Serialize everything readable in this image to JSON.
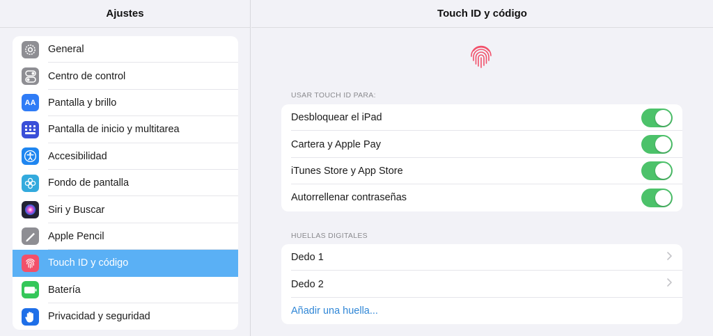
{
  "sidebar": {
    "title": "Ajustes",
    "items": [
      {
        "label": "General",
        "icon": "gear-icon",
        "color": "#8e8e93"
      },
      {
        "label": "Centro de control",
        "icon": "toggles-icon",
        "color": "#8e8e93"
      },
      {
        "label": "Pantalla y brillo",
        "icon": "text-size-icon",
        "color": "#2f7cf6"
      },
      {
        "label": "Pantalla de inicio y multitarea",
        "icon": "grid-icon",
        "color": "#3a4fd8"
      },
      {
        "label": "Accesibilidad",
        "icon": "accessibility-icon",
        "color": "#1f86f0"
      },
      {
        "label": "Fondo de pantalla",
        "icon": "flower-icon",
        "color": "#33aadd"
      },
      {
        "label": "Siri y Buscar",
        "icon": "siri-icon",
        "color": "#222233"
      },
      {
        "label": "Apple Pencil",
        "icon": "pencil-icon",
        "color": "#8e8e93"
      },
      {
        "label": "Touch ID y código",
        "icon": "fingerprint-icon",
        "color": "#f2506a",
        "selected": true
      },
      {
        "label": "Batería",
        "icon": "battery-icon",
        "color": "#34c759"
      },
      {
        "label": "Privacidad y seguridad",
        "icon": "hand-icon",
        "color": "#1f6fe8"
      }
    ],
    "text_size_glyph": "AA"
  },
  "detail": {
    "title": "Touch ID y código",
    "use_section_title": "USAR TOUCH ID PARA:",
    "use_rows": [
      {
        "label": "Desbloquear el iPad",
        "on": true
      },
      {
        "label": "Cartera y Apple Pay",
        "on": true
      },
      {
        "label": "iTunes Store y App Store",
        "on": true
      },
      {
        "label": "Autorrellenar contraseñas",
        "on": true
      }
    ],
    "fingerprints_section_title": "HUELLAS DIGITALES",
    "fingerprint_rows": [
      {
        "label": "Dedo 1"
      },
      {
        "label": "Dedo 2"
      }
    ],
    "add_fingerprint_label": "Añadir una huella...",
    "accent_color": "#4cc26a",
    "link_color": "#2f86d6"
  }
}
